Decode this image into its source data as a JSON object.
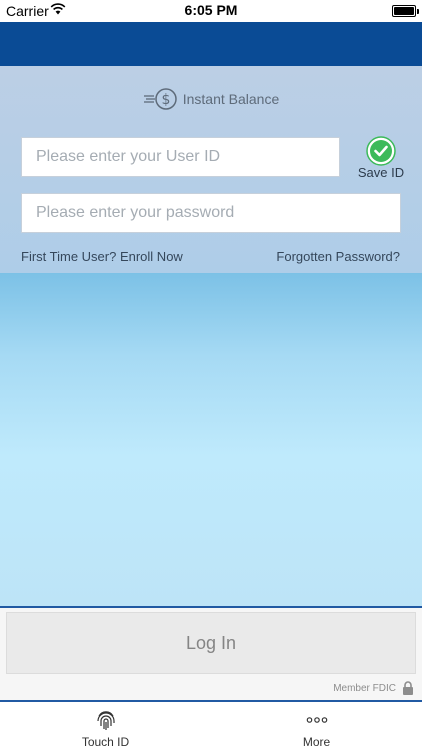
{
  "status_bar": {
    "carrier": "Carrier",
    "time": "6:05 PM"
  },
  "instant_balance": {
    "label": "Instant Balance",
    "icon": "dollar-coin-icon"
  },
  "form": {
    "userid_placeholder": "Please enter your User ID",
    "password_placeholder": "Please enter your password",
    "save_id_label": "Save ID",
    "save_id_checked": true
  },
  "links": {
    "enroll": "First Time User? Enroll Now",
    "forgot": "Forgotten Password?"
  },
  "login": {
    "button_label": "Log In"
  },
  "footer": {
    "fdic": "Member FDIC"
  },
  "tabs": [
    {
      "label": "Touch ID",
      "icon": "fingerprint-icon"
    },
    {
      "label": "More",
      "icon": "more-dots-icon"
    }
  ],
  "colors": {
    "header": "#0a4b95",
    "accent": "#215aa3",
    "check": "#3cba5a"
  }
}
